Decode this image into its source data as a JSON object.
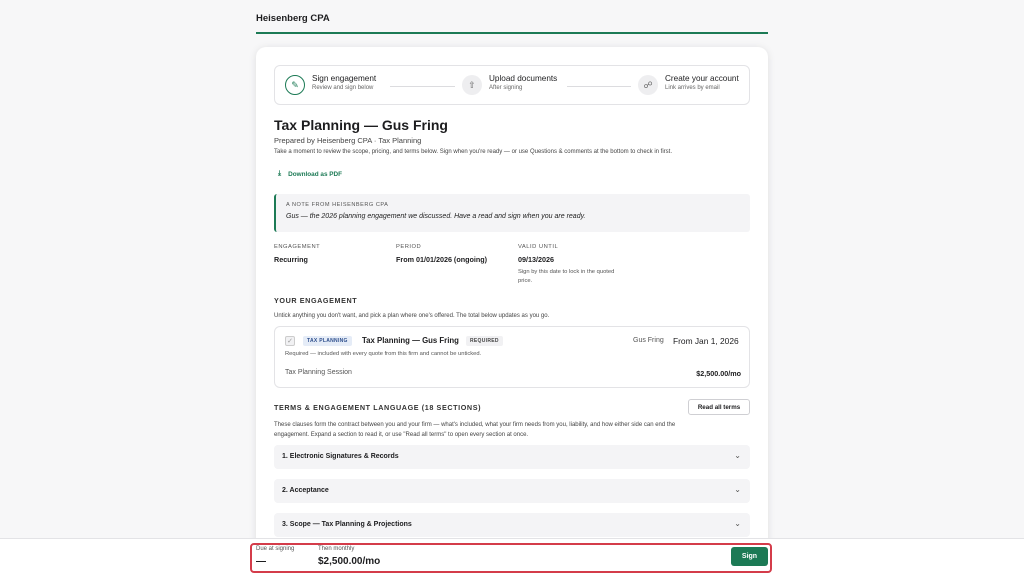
{
  "header": {
    "brand": "Heisenberg CPA"
  },
  "stepper": [
    {
      "title": "Sign engagement",
      "sub": "Review and sign below",
      "icon": "pen-icon"
    },
    {
      "title": "Upload documents",
      "sub": "After signing",
      "icon": "upload-icon"
    },
    {
      "title": "Create your account",
      "sub": "Link arrives by email",
      "icon": "link-icon"
    }
  ],
  "proposal": {
    "title": "Tax Planning — Gus Fring",
    "prepared_by": "Prepared by Heisenberg CPA · Tax Planning",
    "intro": "Take a moment to review the scope, pricing, and terms below. Sign when you're ready — or use Questions & comments at the bottom to check in first.",
    "download_label": "Download as PDF"
  },
  "note": {
    "label": "A NOTE FROM HEISENBERG CPA",
    "text": "Gus — the 2026 planning engagement we discussed. Have a read and sign when you are ready."
  },
  "meta": {
    "engagement_label": "ENGAGEMENT",
    "engagement_value": "Recurring",
    "period_label": "PERIOD",
    "period_value": "From 01/01/2026 (ongoing)",
    "valid_label": "VALID UNTIL",
    "valid_value": "09/13/2026",
    "valid_hint": "Sign by this date to lock in the quoted price."
  },
  "engagement": {
    "label": "YOUR ENGAGEMENT",
    "desc": "Untick anything you don't want, and pick a plan where one's offered. The total below updates as you go.",
    "service": {
      "tag": "TAX PLANNING",
      "name": "Tax Planning — Gus Fring",
      "required_badge": "REQUIRED",
      "client": "Gus Fring",
      "start": "From Jan 1, 2026",
      "note": "Required — included with every quote from this firm and cannot be unticked.",
      "item": "Tax Planning Session",
      "price": "$2,500.00/mo"
    }
  },
  "terms": {
    "label": "TERMS & ENGAGEMENT LANGUAGE (18 SECTIONS)",
    "read_all": "Read all terms",
    "desc_line1": "These clauses form the contract between you and your firm — what's included, what your firm needs from you, liability, and how either side can end the",
    "desc_line2": "engagement. Expand a section to read it, or use \"Read all terms\" to open every section at once.",
    "sections": [
      "1. Electronic Signatures & Records",
      "2. Acceptance",
      "3. Scope — Tax Planning & Projections"
    ]
  },
  "footer": {
    "due_label": "Due at signing",
    "due_value": "—",
    "then_label": "Then monthly",
    "then_value": "$2,500.00/mo",
    "sign_label": "Sign"
  },
  "colors": {
    "accent": "#1c7a55",
    "highlight": "#d43c4a"
  }
}
